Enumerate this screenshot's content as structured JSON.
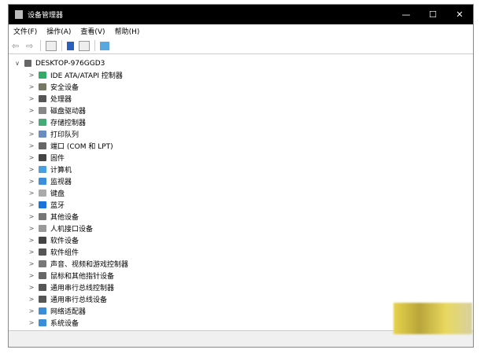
{
  "title": "设备管理器",
  "window_controls": {
    "minimize": "—",
    "maximize": "☐",
    "close": "✕"
  },
  "menu": [
    "文件(F)",
    "操作(A)",
    "查看(V)",
    "帮助(H)"
  ],
  "toolbar": [
    "back-icon",
    "forward-icon",
    "properties-icon",
    "help-icon",
    "view-icon",
    "monitor-icon"
  ],
  "root": "DESKTOP-976GGD3",
  "devices": [
    {
      "label": "IDE ATA/ATAPI 控制器",
      "color": "#3a6"
    },
    {
      "label": "安全设备",
      "color": "#776"
    },
    {
      "label": "处理器",
      "color": "#555"
    },
    {
      "label": "磁盘驱动器",
      "color": "#888"
    },
    {
      "label": "存储控制器",
      "color": "#4a7"
    },
    {
      "label": "打印队列",
      "color": "#6a8cbf"
    },
    {
      "label": "端口 (COM 和 LPT)",
      "color": "#666"
    },
    {
      "label": "固件",
      "color": "#444"
    },
    {
      "label": "计算机",
      "color": "#4a9fe0"
    },
    {
      "label": "监视器",
      "color": "#3c8fd8"
    },
    {
      "label": "键盘",
      "color": "#aaa"
    },
    {
      "label": "蓝牙",
      "color": "#1a73d9"
    },
    {
      "label": "其他设备",
      "color": "#777"
    },
    {
      "label": "人机接口设备",
      "color": "#999"
    },
    {
      "label": "软件设备",
      "color": "#444"
    },
    {
      "label": "软件组件",
      "color": "#555"
    },
    {
      "label": "声音、视频和游戏控制器",
      "color": "#777"
    },
    {
      "label": "鼠标和其他指针设备",
      "color": "#666"
    },
    {
      "label": "通用串行总线控制器",
      "color": "#555"
    },
    {
      "label": "通用串行总线设备",
      "color": "#555"
    },
    {
      "label": "网络适配器",
      "color": "#3a8fd8"
    },
    {
      "label": "系统设备",
      "color": "#3a8fd8"
    }
  ]
}
